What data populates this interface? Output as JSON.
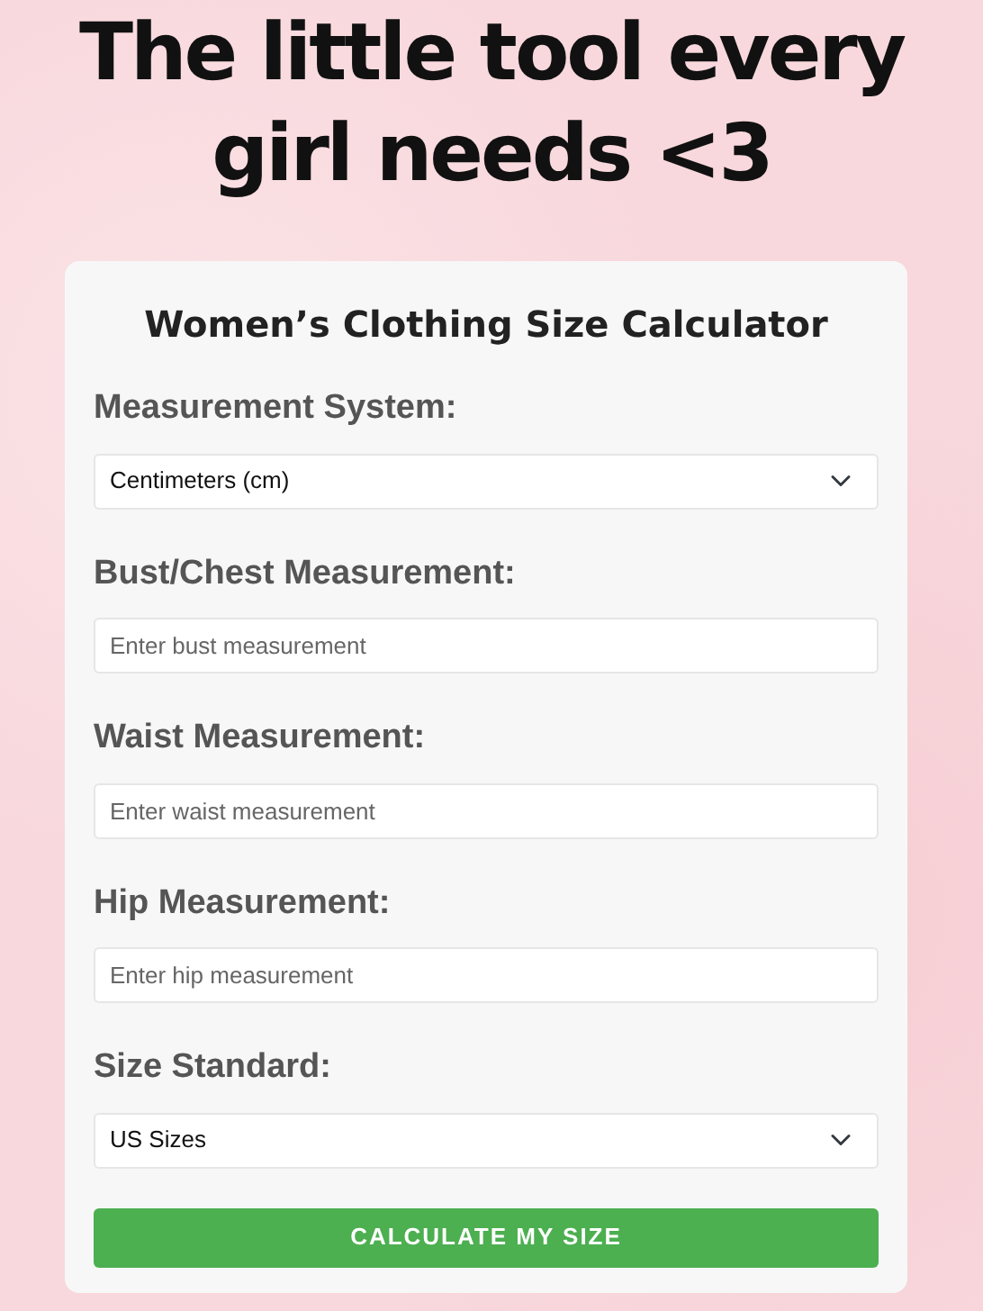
{
  "headline_lines": [
    "The little tool every",
    "girl needs <3"
  ],
  "form": {
    "title": "Women’s Clothing Size Calculator",
    "fields": [
      {
        "kind": "select",
        "label": "Measurement System:",
        "value": "Centimeters (cm)"
      },
      {
        "kind": "input",
        "label": "Bust/Chest Measurement:",
        "placeholder": "Enter bust measurement"
      },
      {
        "kind": "input",
        "label": "Waist Measurement:",
        "placeholder": "Enter waist measurement"
      },
      {
        "kind": "input",
        "label": "Hip Measurement:",
        "placeholder": "Enter hip measurement"
      },
      {
        "kind": "select",
        "label": "Size Standard:",
        "value": "US Sizes"
      }
    ],
    "button": "CALCULATE MY SIZE"
  }
}
